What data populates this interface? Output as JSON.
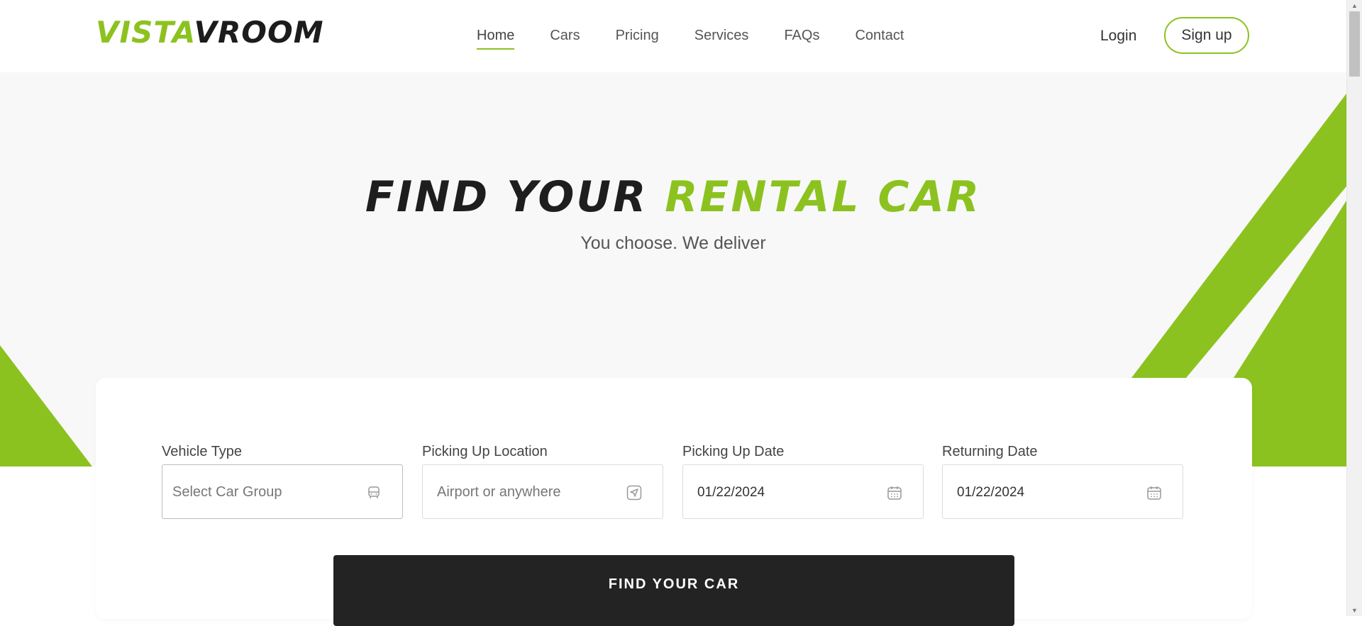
{
  "brand": {
    "logo_part1": "VISTA",
    "logo_part2": "VROOM",
    "accent_color": "#8cc21f",
    "dark_color": "#1c1c1c"
  },
  "nav": {
    "items": [
      {
        "label": "Home",
        "active": true
      },
      {
        "label": "Cars",
        "active": false
      },
      {
        "label": "Pricing",
        "active": false
      },
      {
        "label": "Services",
        "active": false
      },
      {
        "label": "FAQs",
        "active": false
      },
      {
        "label": "Contact",
        "active": false
      }
    ],
    "login_label": "Login",
    "signup_label": "Sign up"
  },
  "hero": {
    "title_part1": "FIND YOUR",
    "title_part2": "RENTAL CAR",
    "subtitle": "You choose. We deliver"
  },
  "booking": {
    "fields": [
      {
        "label": "Vehicle Type",
        "placeholder": "Select Car Group",
        "icon": "car-icon"
      },
      {
        "label": "Picking Up Location",
        "placeholder": "Airport or anywhere",
        "icon": "location-arrow-icon"
      },
      {
        "label": "Picking Up Date",
        "value": "01/22/2024",
        "icon": "calendar-icon"
      },
      {
        "label": "Returning Date",
        "value": "01/22/2024",
        "icon": "calendar-icon"
      }
    ],
    "submit_label": "FIND YOUR CAR"
  }
}
